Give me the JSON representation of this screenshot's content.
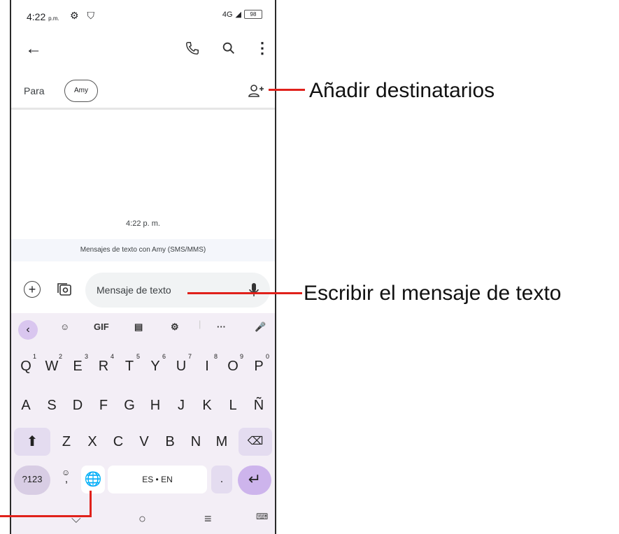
{
  "status_bar": {
    "time": "4:22",
    "ampm": "p.m.",
    "network": "4G",
    "battery": "98"
  },
  "toolbar": {
    "back_icon": "arrow-left-icon",
    "call_icon": "phone-icon",
    "search_icon": "search-icon",
    "more_icon": "more-vert-icon"
  },
  "recipients": {
    "label": "Para",
    "chip": "Amy",
    "add_icon": "add-person-icon"
  },
  "conversation": {
    "timestamp": "4:22 p. m.",
    "info": "Mensajes de texto con Amy (SMS/MMS)"
  },
  "compose": {
    "placeholder": "Mensaje de texto",
    "attach_icon": "plus-circle-icon",
    "gallery_icon": "gallery-camera-icon",
    "mic_icon": "mic-icon"
  },
  "keyboard": {
    "tools": {
      "gif": "GIF",
      "more": "···"
    },
    "row1": [
      "Q",
      "W",
      "E",
      "R",
      "T",
      "Y",
      "U",
      "I",
      "O",
      "P"
    ],
    "row1_nums": [
      "1",
      "2",
      "3",
      "4",
      "5",
      "6",
      "7",
      "8",
      "9",
      "0"
    ],
    "row2": [
      "A",
      "S",
      "D",
      "F",
      "G",
      "H",
      "J",
      "K",
      "L",
      "Ñ"
    ],
    "row3": [
      "Z",
      "X",
      "C",
      "V",
      "B",
      "N",
      "M"
    ],
    "bottom": {
      "numbers": "?123",
      "comma": ",",
      "space": "ES • EN",
      "period": "."
    }
  },
  "annotations": {
    "add_recipients": "Añadir destinatarios",
    "write_message": "Escribir el mensaje de texto"
  },
  "colors": {
    "accent": "#e0211b",
    "keyboard_bg": "#f3eef6",
    "special_key": "#e4dcf0"
  }
}
